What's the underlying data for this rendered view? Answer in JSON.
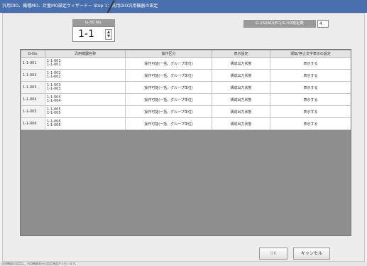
{
  "window": {
    "title": "汎用DIO、機種MO、計量MO設定ウィザード－ Step 1：汎用DIO汎用機器の設定"
  },
  "gnum": {
    "label": "G-50 No.",
    "value": "1-1",
    "up_glyph": "▲",
    "down_glyph": "▼"
  },
  "settings_count": {
    "label": "G-150AD(EC)/G-50設定数",
    "value": "4"
  },
  "table": {
    "headers": [
      "G-No.",
      "汎用機器名称",
      "操作区分",
      "表示設定",
      "運転/停止文字表示の設定"
    ],
    "rows": [
      {
        "no": "1-1-001",
        "name1": "1-1-001",
        "name2": "1-1-001",
        "op": "操作可能(一括、グループ単位)",
        "disp": "構成出力状態",
        "text": "表示する"
      },
      {
        "no": "1-1-002",
        "name1": "1-1-002",
        "name2": "1-1-002",
        "op": "操作可能(一括、グループ単位)",
        "disp": "構成出力状態",
        "text": "表示する"
      },
      {
        "no": "1-1-003",
        "name1": "1-1-003",
        "name2": "1-1-003",
        "op": "操作可能(一括、グループ単位)",
        "disp": "構成出力状態",
        "text": "表示する"
      },
      {
        "no": "1-1-004",
        "name1": "1-1-004",
        "name2": "1-1-004",
        "op": "操作可能(一括、グループ単位)",
        "disp": "構成出力状態",
        "text": "表示する"
      },
      {
        "no": "1-1-005",
        "name1": "1-1-005",
        "name2": "1-1-005",
        "op": "操作可能(一括、グループ単位)",
        "disp": "構成出力状態",
        "text": "表示する"
      },
      {
        "no": "1-1-006",
        "name1": "1-1-006",
        "name2": "1-1-006",
        "op": "操作可能(一括、グループ単位)",
        "disp": "構成出力状態",
        "text": "表示する"
      }
    ]
  },
  "buttons": {
    "ok": "OK",
    "cancel": "キャンセル"
  },
  "status": {
    "text": "汎用機器の設定は、汎用機器表示の設定画面から行います。"
  }
}
